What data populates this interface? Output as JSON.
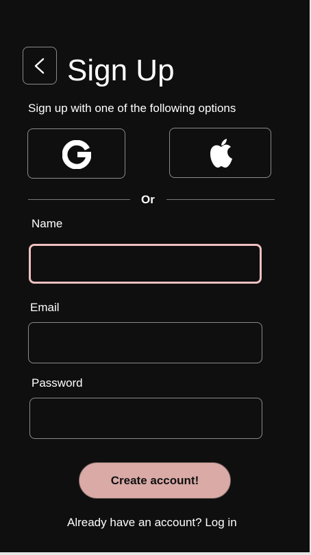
{
  "header": {
    "title": "Sign Up",
    "back_icon": "chevron-left-icon"
  },
  "signup_options": {
    "subtitle": "Sign up with one of the following options",
    "google_icon": "google-icon",
    "apple_icon": "apple-icon",
    "divider_text": "Or"
  },
  "form": {
    "name": {
      "label": "Name",
      "value": "",
      "placeholder": ""
    },
    "email": {
      "label": "Email",
      "value": "",
      "placeholder": ""
    },
    "password": {
      "label": "Password",
      "value": "",
      "placeholder": ""
    },
    "submit_label": "Create account!"
  },
  "footer": {
    "prompt": "Already have an account?",
    "login_link": "Log in"
  },
  "colors": {
    "background": "#0f0f0f",
    "text": "#ffffff",
    "border": "#8c8c8c",
    "focus_border": "#f0c0c0",
    "accent_button": "#d9aaa6",
    "page_frame": "#e6e6e6"
  }
}
